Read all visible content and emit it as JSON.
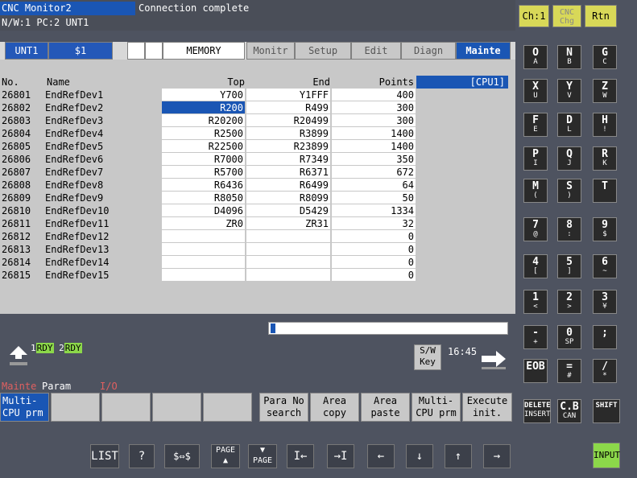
{
  "header": {
    "app_title": "CNC Monitor2",
    "connection_message": "Connection complete",
    "network_info": "N/W:1 PC:2 UNT1"
  },
  "modebar": {
    "unit": "UNT1",
    "program": "$1",
    "mode": "MEMORY",
    "tabs": [
      "Monitr",
      "Setup",
      "Edit",
      "Diagn",
      "Mainte"
    ],
    "active_tab": "Mainte"
  },
  "table": {
    "headers": {
      "no": "No.",
      "name": "Name",
      "top": "Top",
      "end": "End",
      "points": "Points",
      "cpu": "[CPU1]"
    },
    "rows": [
      {
        "no": "26801",
        "name": "EndRefDev1",
        "top": "Y700",
        "end": "Y1FFF",
        "points": "400"
      },
      {
        "no": "26802",
        "name": "EndRefDev2",
        "top": "R200",
        "end": "R499",
        "points": "300"
      },
      {
        "no": "26803",
        "name": "EndRefDev3",
        "top": "R20200",
        "end": "R20499",
        "points": "300"
      },
      {
        "no": "26804",
        "name": "EndRefDev4",
        "top": "R2500",
        "end": "R3899",
        "points": "1400"
      },
      {
        "no": "26805",
        "name": "EndRefDev5",
        "top": "R22500",
        "end": "R23899",
        "points": "1400"
      },
      {
        "no": "26806",
        "name": "EndRefDev6",
        "top": "R7000",
        "end": "R7349",
        "points": "350"
      },
      {
        "no": "26807",
        "name": "EndRefDev7",
        "top": "R5700",
        "end": "R6371",
        "points": "672"
      },
      {
        "no": "26808",
        "name": "EndRefDev8",
        "top": "R6436",
        "end": "R6499",
        "points": "64"
      },
      {
        "no": "26809",
        "name": "EndRefDev9",
        "top": "R8050",
        "end": "R8099",
        "points": "50"
      },
      {
        "no": "26810",
        "name": "EndRefDev10",
        "top": "D4096",
        "end": "D5429",
        "points": "1334"
      },
      {
        "no": "26811",
        "name": "EndRefDev11",
        "top": "ZR0",
        "end": "ZR31",
        "points": "32"
      },
      {
        "no": "26812",
        "name": "EndRefDev12",
        "top": "",
        "end": "",
        "points": "0"
      },
      {
        "no": "26813",
        "name": "EndRefDev13",
        "top": "",
        "end": "",
        "points": "0"
      },
      {
        "no": "26814",
        "name": "EndRefDev14",
        "top": "",
        "end": "",
        "points": "0"
      },
      {
        "no": "26815",
        "name": "EndRefDev15",
        "top": "",
        "end": "",
        "points": "0"
      }
    ],
    "selected_row": 1
  },
  "status": {
    "rdy1_num": "1",
    "rdy1": "RDY",
    "rdy2_num": "2",
    "rdy2": "RDY",
    "sw_key": "S/W Key",
    "time": "16:45"
  },
  "menu": {
    "group_mainte": "Mainte",
    "group_param": "Param",
    "group_io": "I/O",
    "softkeys": [
      "Multi- CPU prm",
      "",
      "",
      "",
      "",
      "Para No search",
      "Area copy",
      "Area paste",
      "Multi- CPU prm",
      "Execute init."
    ]
  },
  "nav": {
    "list": "LIST",
    "help": "?",
    "switch": "$⇔$",
    "page_up": "PAGE ▲",
    "page_down": "▼ PAGE",
    "home": "I←",
    "end": "→I",
    "left": "←",
    "down": "↓",
    "up": "↑",
    "right": "→"
  },
  "keypad": {
    "ch": "Ch:1",
    "cnc_chg": "CNC Chg",
    "rtn": "Rtn",
    "keys": [
      [
        "O",
        "A"
      ],
      [
        "N",
        "B"
      ],
      [
        "G",
        "C"
      ],
      [
        "X",
        "U"
      ],
      [
        "Y",
        "V"
      ],
      [
        "Z",
        "W"
      ],
      [
        "F",
        "E"
      ],
      [
        "D",
        "L"
      ],
      [
        "H",
        "!"
      ],
      [
        "P",
        "I"
      ],
      [
        "Q",
        "J"
      ],
      [
        "R",
        "K"
      ],
      [
        "M",
        "("
      ],
      [
        "S",
        ")"
      ],
      [
        "T",
        ""
      ],
      [
        "7",
        "@"
      ],
      [
        "8",
        ":"
      ],
      [
        "9",
        "$"
      ],
      [
        "4",
        "["
      ],
      [
        "5",
        "]"
      ],
      [
        "6",
        "~"
      ],
      [
        "1",
        "<"
      ],
      [
        "2",
        ">"
      ],
      [
        "3",
        "¥"
      ],
      [
        "-",
        "+"
      ],
      [
        "0",
        "SP"
      ],
      [
        ";",
        ""
      ],
      [
        "EOB",
        ""
      ],
      [
        "=",
        "#"
      ],
      [
        "/",
        "*"
      ],
      [
        "DELETE",
        "INSERT"
      ],
      [
        "C.B",
        "CAN"
      ],
      [
        "SHIFT",
        ""
      ]
    ],
    "input": "INPUT"
  }
}
